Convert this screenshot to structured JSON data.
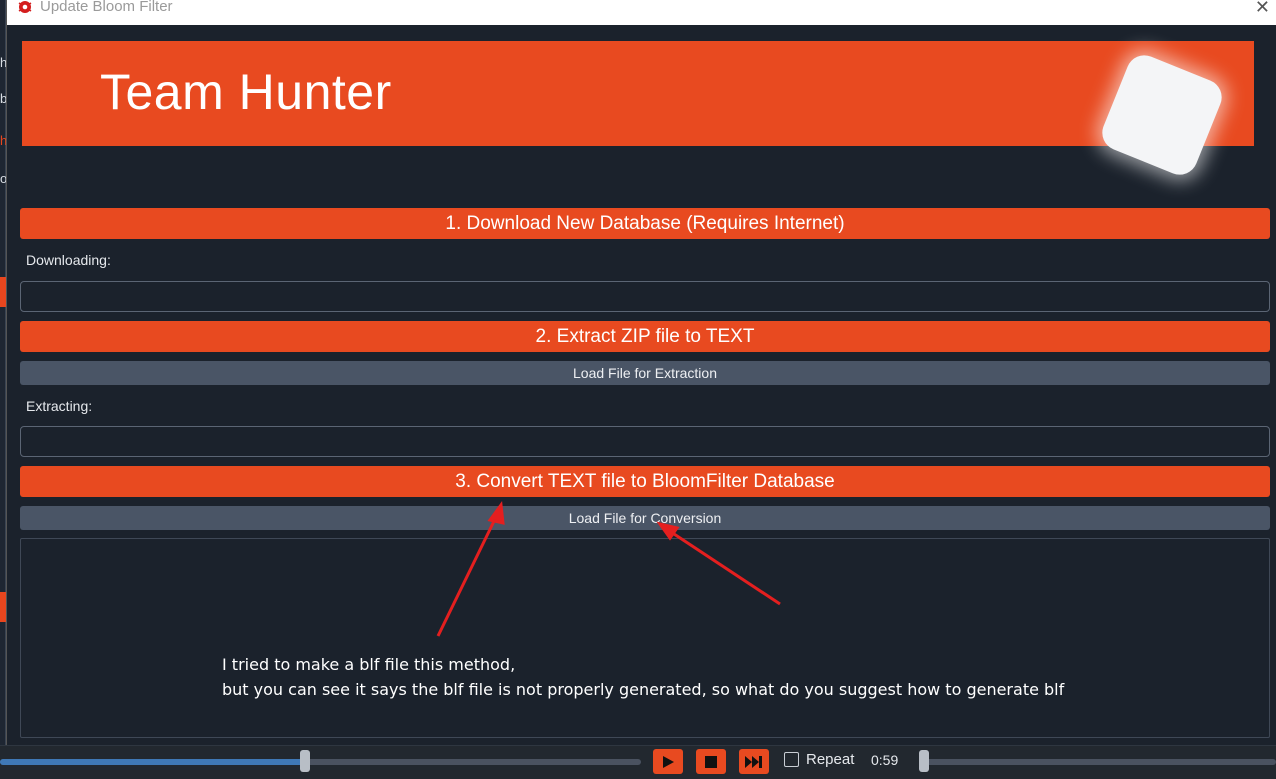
{
  "window": {
    "title": "Update Bloom Filter",
    "close_glyph": "✕"
  },
  "banner": {
    "brand_text": "Team Hunter",
    "brand_color": "#e84a20"
  },
  "background_app": {
    "fragments": [
      "h",
      "b",
      "h",
      "o"
    ]
  },
  "steps": {
    "download_button": "1. Download New Database (Requires Internet)",
    "downloading_label": "Downloading:",
    "extract_button": "2. Extract ZIP file to TEXT",
    "load_extraction_button": "Load File for Extraction",
    "extracting_label": "Extracting:",
    "convert_button": "3. Convert TEXT file to BloomFilter Database",
    "load_conversion_button": "Load File for Conversion"
  },
  "annotation": {
    "line1": "I tried to make a blf file this method,",
    "line2": "but you can see it says the blf file is not properly generated, so what do you suggest how to generate blf",
    "arrow_color": "#e41f1f"
  },
  "mediabar": {
    "seek_progress": 0.475,
    "repeat_label": "Repeat",
    "repeat_checked": false,
    "time": "0:59",
    "volume_level": 0.0,
    "icons": [
      "play-icon",
      "stop-icon",
      "fast-forward-icon"
    ]
  }
}
